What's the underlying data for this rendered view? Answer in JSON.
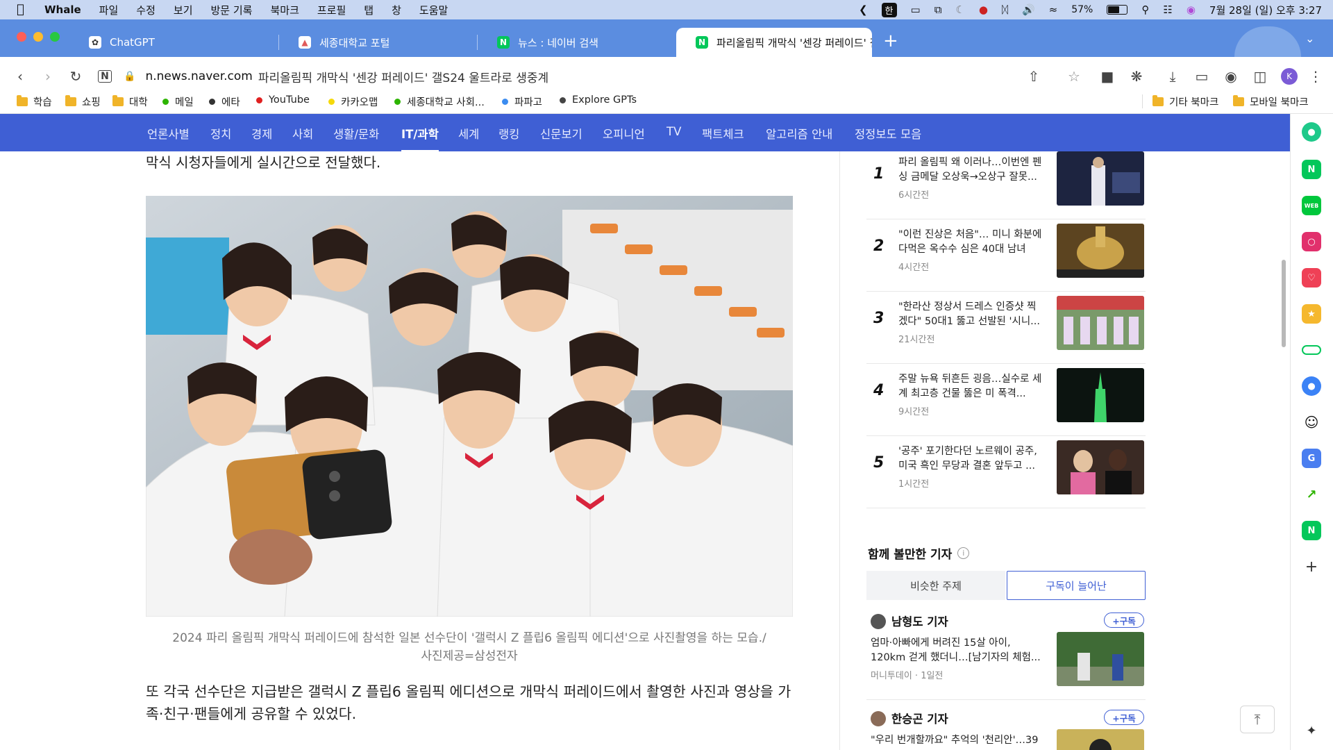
{
  "menubar": {
    "app": "Whale",
    "items": [
      "파일",
      "수정",
      "보기",
      "방문 기록",
      "북마크",
      "프로필",
      "탭",
      "창",
      "도움말"
    ],
    "input_method": "한",
    "battery": "57%",
    "battery_level": 0.57,
    "datetime": "7월 28일 (일) 오후 3:27"
  },
  "tabs": [
    {
      "title": "ChatGPT",
      "icon": "chatgpt-icon",
      "color": "#ffffff"
    },
    {
      "title": "세종대학교 포털",
      "icon": "sejong-icon",
      "color": "#e05b5b"
    },
    {
      "title": "뉴스 : 네이버 검색",
      "icon": "naver-icon",
      "color": "#03c75a"
    },
    {
      "title": "파리올림픽 개막식 '센강 퍼레이드' 갤",
      "icon": "naver-icon",
      "color": "#03c75a",
      "active": true
    }
  ],
  "address": {
    "host": "n.news.naver.com",
    "path": "파리올림픽 개막식 '센강 퍼레이드' 갤S24 울트라로 생중계"
  },
  "bookmarks": [
    {
      "label": "학습",
      "type": "folder"
    },
    {
      "label": "쇼핑",
      "type": "folder"
    },
    {
      "label": "대학",
      "type": "folder"
    },
    {
      "label": "메일",
      "type": "dot",
      "color": "#2db400"
    },
    {
      "label": "에타",
      "type": "dot",
      "color": "#333333"
    },
    {
      "label": "YouTube",
      "type": "dot",
      "color": "#e02020"
    },
    {
      "label": "카카오맵",
      "type": "dot",
      "color": "#f5d90a"
    },
    {
      "label": "세종대학교 사회...",
      "type": "dot",
      "color": "#2db400"
    },
    {
      "label": "파파고",
      "type": "dot",
      "color": "#3b8cf0"
    },
    {
      "label": "Explore GPTs",
      "type": "dot",
      "color": "#444444"
    }
  ],
  "bookmarks_right": [
    {
      "label": "기타 북마크"
    },
    {
      "label": "모바일 북마크"
    }
  ],
  "nav": {
    "items": [
      "언론사별",
      "정치",
      "경제",
      "사회",
      "생활/문화",
      "IT/과학",
      "세계",
      "랭킹",
      "신문보기",
      "오피니언",
      "TV",
      "팩트체크",
      "알고리즘 안내",
      "정정보도 모음"
    ],
    "active": "IT/과학"
  },
  "article": {
    "top_text": "막식 시청자들에게 실시간으로 전달했다.",
    "caption_line1": "2024 파리 올림픽 개막식 퍼레이드에 참석한 일본 선수단이 '갤럭시 Z 플립6 올림픽 에디션'으로 사진촬영을 하는 모습./",
    "caption_line2": "사진제공=삼성전자",
    "body": "또 각국 선수단은 지급받은 갤럭시 Z 플립6 올림픽 에디션으로 개막식 퍼레이드에서 촬영한 사진과 영상을 가족·친구·팬들에게 공유할 수 있었다."
  },
  "ranking": [
    {
      "num": "1",
      "title": "파리 올림픽 왜 이러나…이번엔 펜싱 금메달 오상욱→오상구 잘못...",
      "time": "6시간전"
    },
    {
      "num": "2",
      "title": "\"이런 진상은 처음\"… 미니 화분에 다먹은 옥수수 심은 40대 남녀",
      "time": "4시간전"
    },
    {
      "num": "3",
      "title": "\"한라산 정상서 드레스 인증샷 찍겠다\" 50대1 뚫고 선발된 '시니...",
      "time": "21시간전"
    },
    {
      "num": "4",
      "title": "주말 뉴욕 뒤흔든 굉음…실수로 세계 최고층 건물 뚫은 미 폭격...",
      "time": "9시간전"
    },
    {
      "num": "5",
      "title": "'공주' 포기한다던 노르웨이 공주, 미국 흑인 무당과 결혼 앞두고 ...",
      "time": "1시간전"
    }
  ],
  "related": {
    "title": "함께 볼만한 기자",
    "tabs": [
      "비슷한 주제",
      "구독이 늘어난"
    ],
    "active_tab": "구독이 늘어난",
    "subscribe_label": "+구독",
    "reporters": [
      {
        "name": "남형도 기자",
        "title": "엄마·아빠에게 버려진 15살 아이, 120km 걷게 했더니…[남기자의 체험...",
        "press": "머니투데이 · 1일전"
      },
      {
        "name": "한승곤 기자",
        "title": "\"우리 번개할까요\" 추억의 '천리안'…39",
        "press": ""
      }
    ]
  },
  "colors": {
    "tabstrip": "#5b8de0",
    "naver_nav": "#3f5fd4",
    "menubar": "#c8d7f2"
  },
  "sidebar_icons": [
    "whale-green-icon",
    "naver-n-icon",
    "webtoon-icon",
    "instagram-icon",
    "pocket-icon",
    "star-icon",
    "green-bar-icon",
    "map-pin-icon",
    "smile-icon",
    "translate-icon",
    "chart-icon",
    "naver-pay-icon",
    "plus-icon",
    "pin-icon"
  ]
}
